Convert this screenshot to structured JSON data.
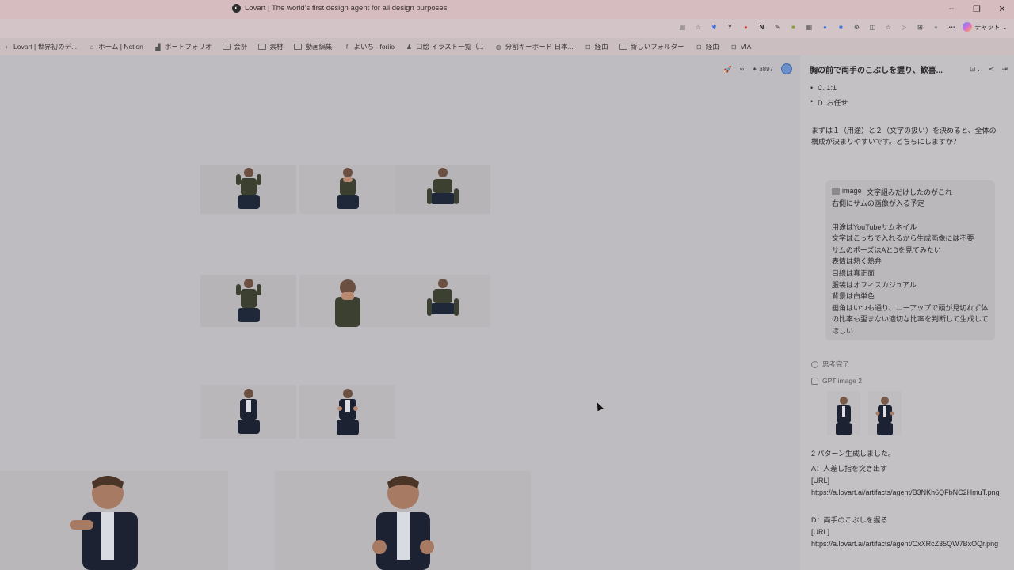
{
  "window": {
    "title": "Lovart | The world's first design agent for all design purposes"
  },
  "toolbar": {
    "extensions": [
      {
        "icon": "reader-icon",
        "glyph": "▤",
        "color": "#6a6a6a"
      },
      {
        "icon": "star-icon",
        "glyph": "☆",
        "color": "#6a6a6a"
      },
      {
        "icon": "pin-ext-icon",
        "glyph": "✱",
        "color": "#3f6fd6"
      },
      {
        "icon": "y-ext-icon",
        "glyph": "Y",
        "color": "#555555"
      },
      {
        "icon": "red-ext-icon",
        "glyph": "●",
        "color": "#d64545"
      },
      {
        "icon": "notion-ext-icon",
        "glyph": "N",
        "color": "#111111"
      },
      {
        "icon": "pen-ext-icon",
        "glyph": "✎",
        "color": "#333333"
      },
      {
        "icon": "green-ext-icon",
        "glyph": "■",
        "color": "#8a9a3a"
      },
      {
        "icon": "grid-ext-icon",
        "glyph": "▦",
        "color": "#555555"
      },
      {
        "icon": "blue-circle-ext-icon",
        "glyph": "●",
        "color": "#3f6fd6"
      },
      {
        "icon": "blue-square-ext-icon",
        "glyph": "■",
        "color": "#3f6fd6"
      },
      {
        "icon": "puzzle-icon",
        "glyph": "⚙",
        "color": "#555555"
      },
      {
        "icon": "split-view-icon",
        "glyph": "◫",
        "color": "#555555"
      },
      {
        "icon": "favorites-icon",
        "glyph": "☆",
        "color": "#555555"
      },
      {
        "icon": "send-icon",
        "glyph": "▷",
        "color": "#555555"
      },
      {
        "icon": "collections-icon",
        "glyph": "⊞",
        "color": "#555555"
      },
      {
        "icon": "profile-icon",
        "glyph": "●",
        "color": "#8a8a8a"
      },
      {
        "icon": "more-icon",
        "glyph": "⋯",
        "color": "#444444"
      }
    ],
    "chat_label": "チャット"
  },
  "bookmarks": [
    {
      "icon": "lovart-favicon",
      "label": "Lovart | 世界初のデ..."
    },
    {
      "icon": "home-icon",
      "label": "ホーム | Notion"
    },
    {
      "icon": "chart-icon",
      "label": "ポートフォリオ"
    },
    {
      "icon": "folder-icon",
      "label": "会計"
    },
    {
      "icon": "folder-icon",
      "label": "素材"
    },
    {
      "icon": "folder-icon",
      "label": "動画編集"
    },
    {
      "icon": "facebook-icon",
      "label": "よいち - foriio"
    },
    {
      "icon": "person-icon",
      "label": "口絵 イラスト一覧（..."
    },
    {
      "icon": "globe-icon",
      "label": "分割キーボード 日本..."
    },
    {
      "icon": "link-icon",
      "label": "経由"
    },
    {
      "icon": "folder-icon",
      "label": "新しいフォルダー"
    },
    {
      "icon": "link-icon",
      "label": "経由"
    },
    {
      "icon": "link-icon",
      "label": "VIA"
    }
  ],
  "canvas": {
    "credits": "3897",
    "infinity": "∞"
  },
  "panel": {
    "title": "胸の前で両手のこぶしを握り、歓喜...",
    "options": [
      "C. 1:1",
      "D. お任せ"
    ],
    "question": "まずは１（用途）と２（文字の扱い）を決めると、全体の構成が決まりやすいです。どちらにしますか？",
    "user_message": {
      "chip": "image",
      "lines": [
        "文字組みだけしたのがこれ",
        "右側にサムの画像が入る予定",
        "",
        "用途はYouTubeサムネイル",
        "文字はこっちで入れるから生成画像には不要",
        "サムのポーズはAとDを見てみたい",
        "表情は熱く熱弁",
        "目線は真正面",
        "服装はオフィスカジュアル",
        "背景は白単色",
        "画角はいつも通り、ニーアップで頭が見切れず体の比率も歪まない適切な比率を判断して生成してほしい"
      ]
    },
    "thinking_label": "思考完了",
    "model_label": "GPT image 2",
    "result_text": "2 パターン生成しました。",
    "result_a_title": "A：人差し指を突き出す",
    "result_a_url_label": "[URL]",
    "result_a_url": "https://a.lovart.ai/artifacts/agent/B3NKh6QFbNC2HmuT.png",
    "result_d_title": "D：両手のこぶしを握る",
    "result_d_url_label": "[URL]",
    "result_d_url": "https://a.lovart.ai/artifacts/agent/CxXRcZ35QW7BxOQr.png"
  }
}
